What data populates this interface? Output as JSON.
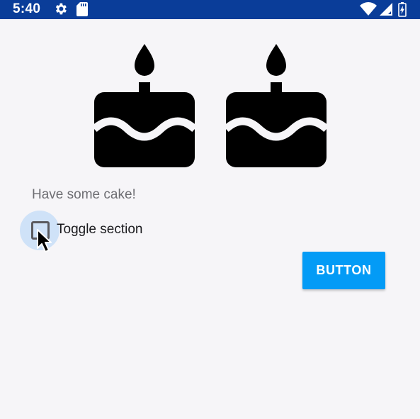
{
  "status_bar": {
    "time": "5:40",
    "background_color": "#0a3d99",
    "icons": [
      "gear-icon",
      "sd-card-icon",
      "wifi-icon",
      "signal-icon",
      "battery-icon"
    ]
  },
  "content": {
    "cake_icons": [
      "cake-icon",
      "cake-icon"
    ],
    "message": "Have some cake!",
    "checkbox": {
      "label": "Toggle section",
      "checked": false
    },
    "button": {
      "label": "BUTTON",
      "color": "#039bf6"
    }
  }
}
